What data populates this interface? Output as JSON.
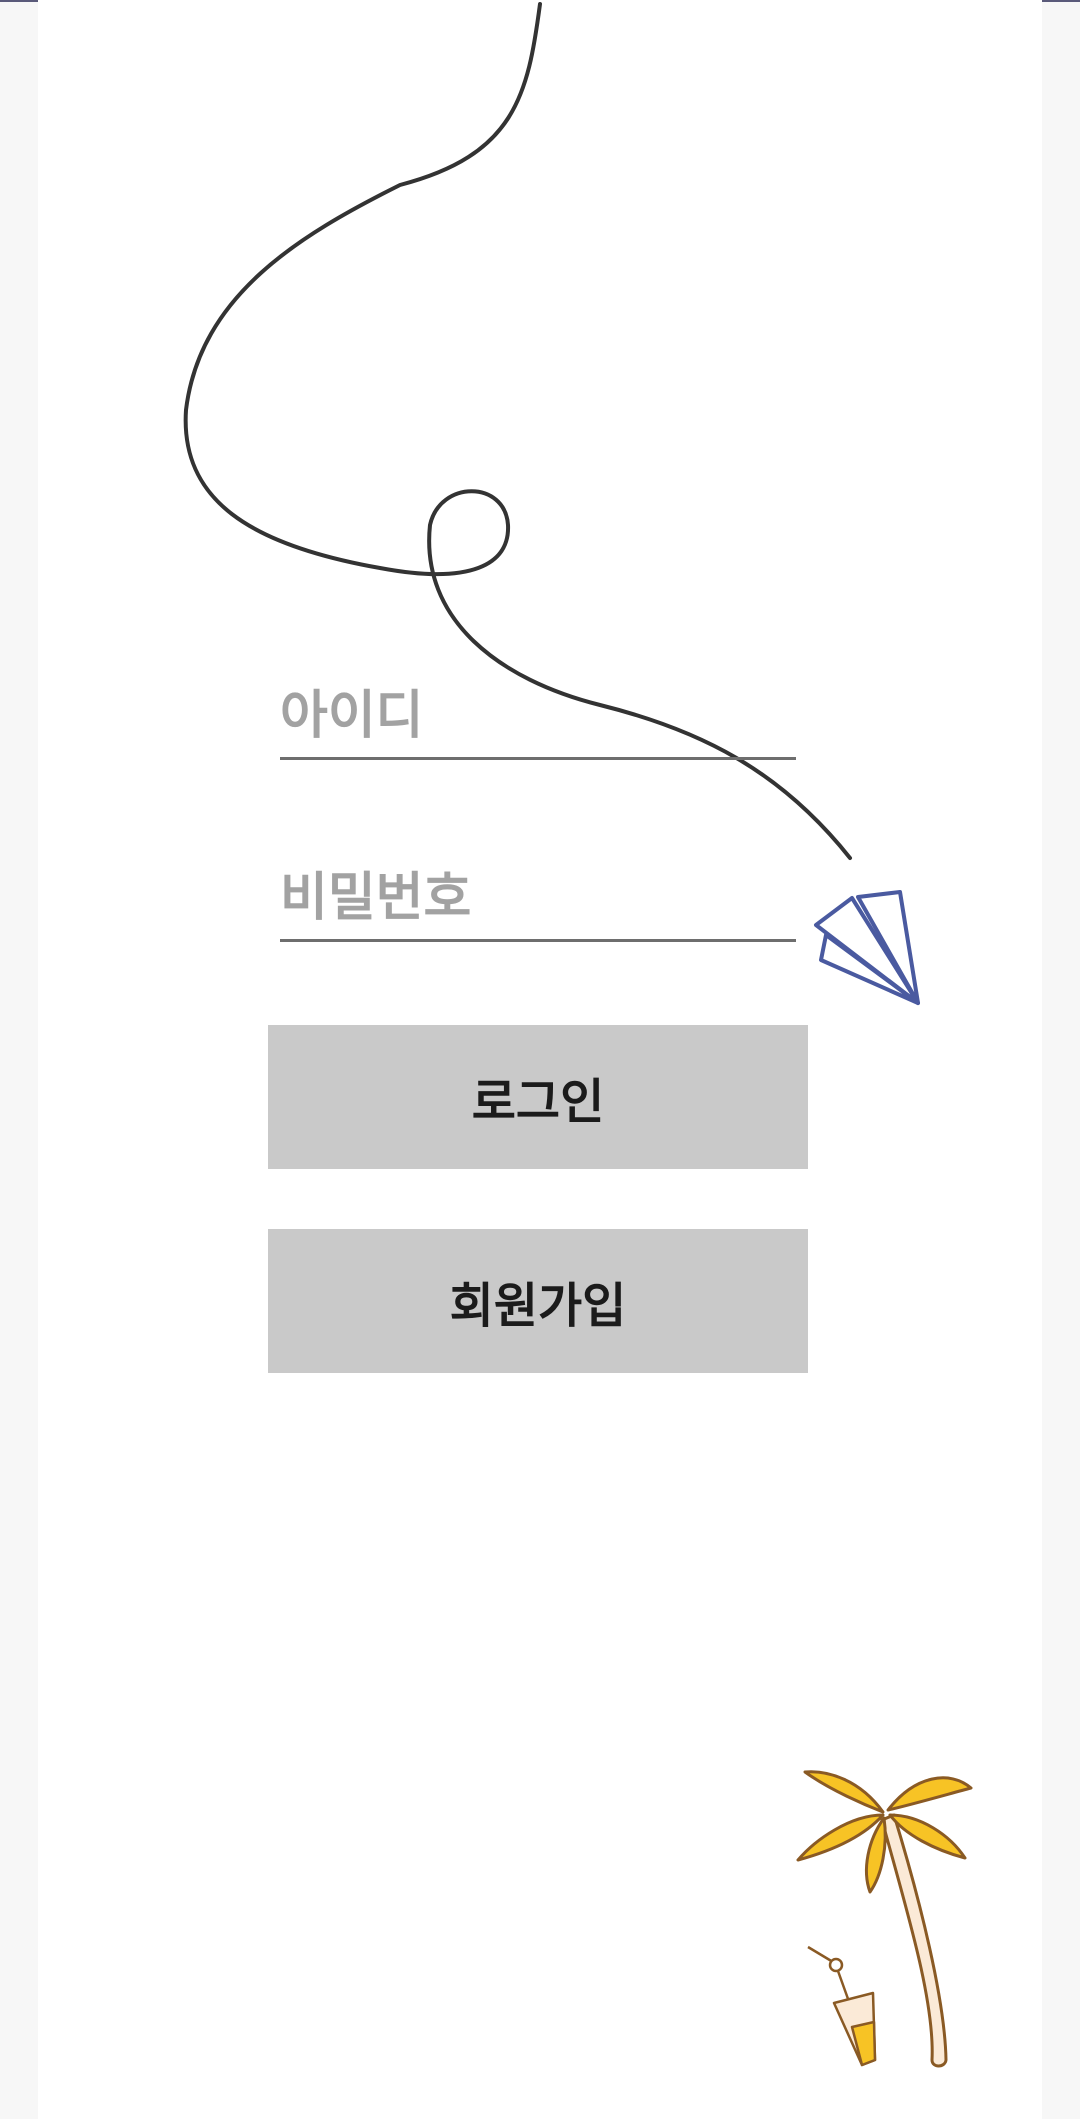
{
  "login_form": {
    "id_placeholder": "아이디",
    "password_placeholder": "비밀번호",
    "login_label": "로그인",
    "signup_label": "회원가입"
  },
  "decorations": {
    "path_icon": "flight-path-line",
    "plane_icon": "paper-airplane-icon",
    "palm_icon": "palm-tree-icon",
    "drink_icon": "cocktail-glass-icon",
    "plane_color": "#4a5aa0",
    "palm_leaf_color": "#f7c325",
    "palm_outline_color": "#8a5a24"
  },
  "colors": {
    "button_bg": "#c9c9c9",
    "placeholder": "#a2a2a2",
    "underline": "#6e6e6e"
  }
}
